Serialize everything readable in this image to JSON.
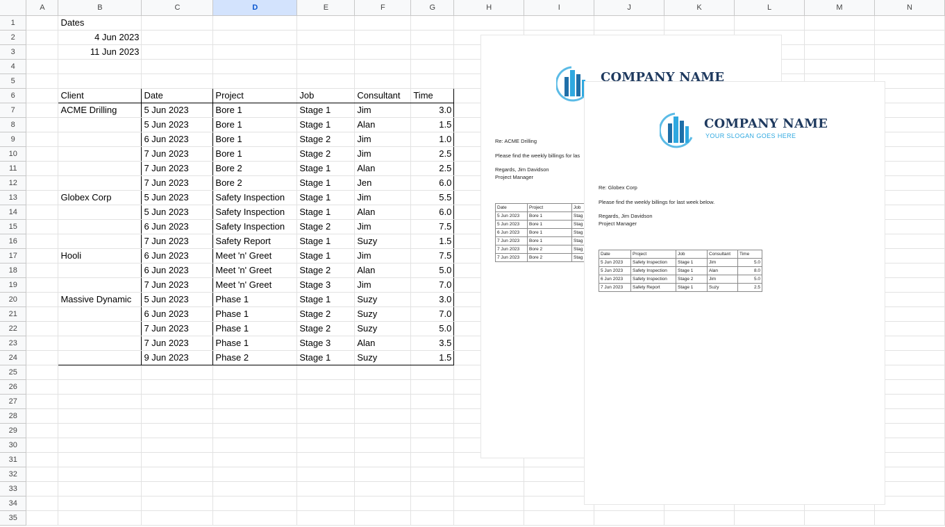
{
  "columns": [
    "A",
    "B",
    "C",
    "D",
    "E",
    "F",
    "G",
    "H",
    "I",
    "J",
    "K",
    "L",
    "M",
    "N"
  ],
  "selected_column": "D",
  "rows": [
    "1",
    "2",
    "3",
    "4",
    "5",
    "6",
    "7",
    "8",
    "9",
    "10",
    "11",
    "12",
    "13",
    "14",
    "15",
    "16",
    "17",
    "18",
    "19",
    "20",
    "21",
    "22",
    "23",
    "24",
    "25",
    "26",
    "27",
    "28",
    "29",
    "30",
    "31",
    "32",
    "33",
    "34",
    "35"
  ],
  "dates": {
    "label": "Dates",
    "start": "4 Jun 2023",
    "end": "11 Jun 2023"
  },
  "table": {
    "headers": [
      "Client",
      "Date",
      "Project",
      "Job",
      "Consultant",
      "Time"
    ],
    "rows": [
      [
        "ACME Drilling",
        "5 Jun 2023",
        "Bore 1",
        "Stage 1",
        "Jim",
        "3.0"
      ],
      [
        "",
        "5 Jun 2023",
        "Bore 1",
        "Stage 1",
        "Alan",
        "1.5"
      ],
      [
        "",
        "6 Jun 2023",
        "Bore 1",
        "Stage 2",
        "Jim",
        "1.0"
      ],
      [
        "",
        "7 Jun 2023",
        "Bore 1",
        "Stage 2",
        "Jim",
        "2.5"
      ],
      [
        "",
        "7 Jun 2023",
        "Bore 2",
        "Stage 1",
        "Alan",
        "2.5"
      ],
      [
        "",
        "7 Jun 2023",
        "Bore 2",
        "Stage 1",
        "Jen",
        "6.0"
      ],
      [
        "Globex Corp",
        "5 Jun 2023",
        "Safety Inspection",
        "Stage 1",
        "Jim",
        "5.5"
      ],
      [
        "",
        "5 Jun 2023",
        "Safety Inspection",
        "Stage 1",
        "Alan",
        "6.0"
      ],
      [
        "",
        "6 Jun 2023",
        "Safety Inspection",
        "Stage 2",
        "Jim",
        "7.5"
      ],
      [
        "",
        "7 Jun 2023",
        "Safety Report",
        "Stage 1",
        "Suzy",
        "1.5"
      ],
      [
        "Hooli",
        "6 Jun 2023",
        "Meet 'n' Greet",
        "Stage 1",
        "Jim",
        "7.5"
      ],
      [
        "",
        "6 Jun 2023",
        "Meet 'n' Greet",
        "Stage 2",
        "Alan",
        "5.0"
      ],
      [
        "",
        "7 Jun 2023",
        "Meet 'n' Greet",
        "Stage 3",
        "Jim",
        "7.0"
      ],
      [
        "Massive Dynamic",
        "5 Jun 2023",
        "Phase 1",
        "Stage 1",
        "Suzy",
        "3.0"
      ],
      [
        "",
        "6 Jun 2023",
        "Phase 1",
        "Stage 2",
        "Suzy",
        "7.0"
      ],
      [
        "",
        "7 Jun 2023",
        "Phase 1",
        "Stage 2",
        "Suzy",
        "5.0"
      ],
      [
        "",
        "7 Jun 2023",
        "Phase 1",
        "Stage 3",
        "Alan",
        "3.5"
      ],
      [
        "",
        "9 Jun 2023",
        "Phase 2",
        "Stage 1",
        "Suzy",
        "1.5"
      ]
    ]
  },
  "doc1": {
    "company": "COMPANY NAME",
    "re": "Re: ACME Drilling",
    "body": "Please find the weekly billings for las",
    "regards": "Regards, Jim Davidson",
    "role": "Project Manager",
    "headers": [
      "Date",
      "Project",
      "Job"
    ],
    "rows": [
      [
        "5 Jun 2023",
        "Bore 1",
        "Stag"
      ],
      [
        "5 Jun 2023",
        "Bore 1",
        "Stag"
      ],
      [
        "6 Jun 2023",
        "Bore 1",
        "Stag"
      ],
      [
        "7 Jun 2023",
        "Bore 1",
        "Stag"
      ],
      [
        "7 Jun 2023",
        "Bore 2",
        "Stag"
      ],
      [
        "7 Jun 2023",
        "Bore 2",
        "Stag"
      ]
    ]
  },
  "doc2": {
    "company": "COMPANY NAME",
    "slogan": "YOUR SLOGAN GOES HERE",
    "re": "Re: Globex Corp",
    "body": "Please find the weekly billings for last week below.",
    "regards": "Regards, Jim Davidson",
    "role": "Project Manager",
    "headers": [
      "Date",
      "Project",
      "Job",
      "Consultant",
      "Time"
    ],
    "rows": [
      [
        "5 Jun 2023",
        "Safety Inspection",
        "Stage 1",
        "Jim",
        "5.0"
      ],
      [
        "5 Jun 2023",
        "Safety Inspection",
        "Stage 1",
        "Alan",
        "8.0"
      ],
      [
        "6 Jun 2023",
        "Safety Inspection",
        "Stage 2",
        "Jim",
        "5.0"
      ],
      [
        "7 Jun 2023",
        "Safety Report",
        "Stage 1",
        "Suzy",
        "2.5"
      ]
    ]
  },
  "colors": {
    "selected_header_bg": "#d3e3fd",
    "logo_blue": "#2fa8e0",
    "company_navy": "#1f3a5f"
  }
}
